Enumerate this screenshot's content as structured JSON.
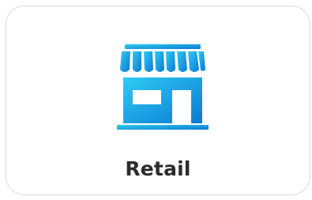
{
  "card": {
    "label": "Retail",
    "icon": "store-icon",
    "icon_gradient": [
      "#29c3ee",
      "#0e7fd6"
    ]
  }
}
